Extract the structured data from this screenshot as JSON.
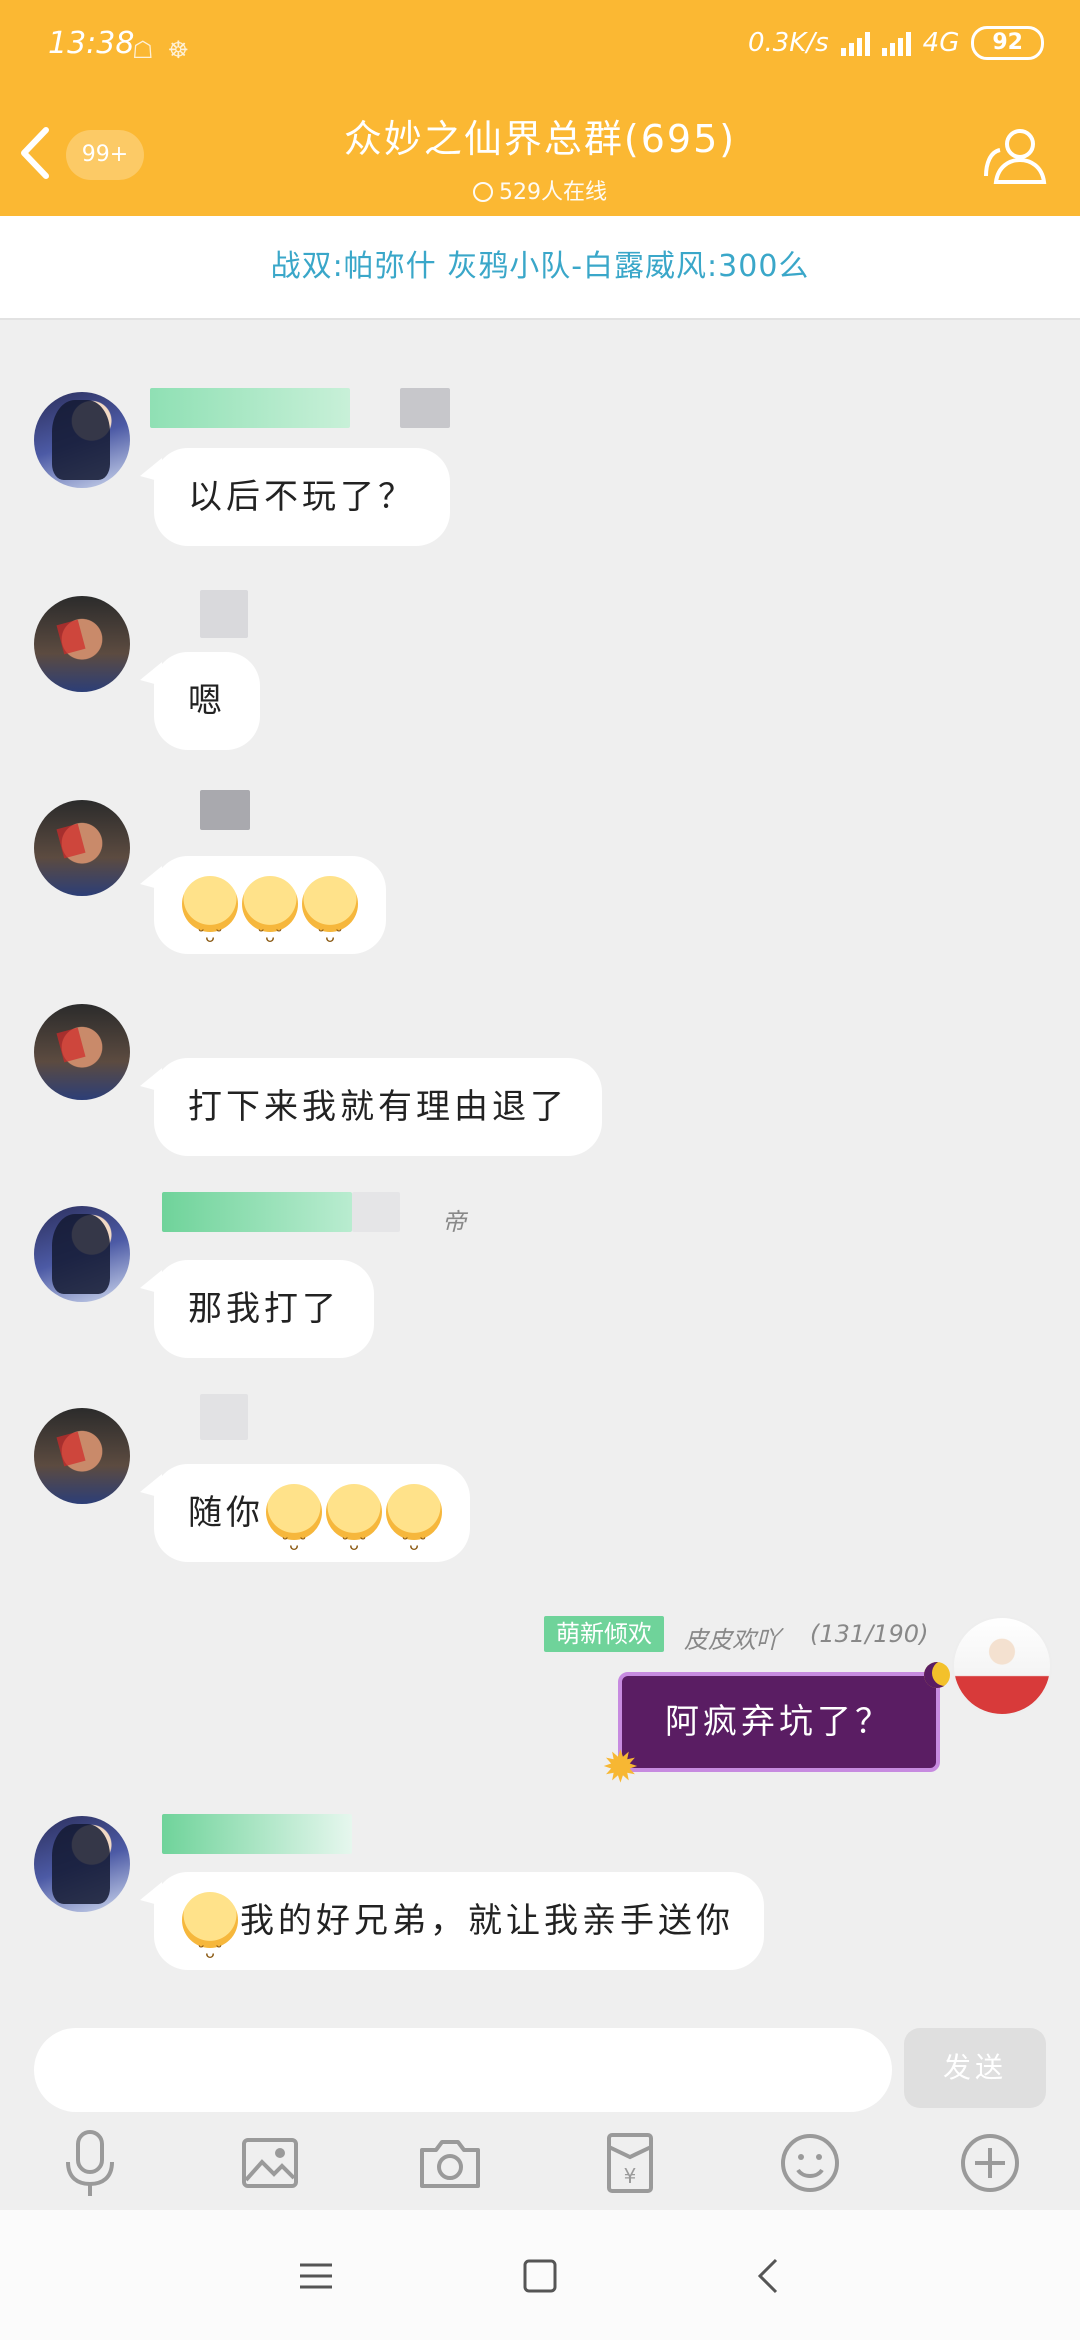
{
  "status_bar": {
    "time": "13:38",
    "speed": "0.3K/s",
    "network": "4G",
    "battery": "92"
  },
  "header": {
    "unread": "99+",
    "title": "众妙之仙界总群(695)",
    "online": "529人在线"
  },
  "notice": "战双:帕弥什 灰鸦小队-白露威风:300么",
  "messages": [
    {
      "text": "以后不玩了？"
    },
    {
      "text": "嗯"
    },
    {
      "text": ""
    },
    {
      "text": "打下来我就有理由退了"
    },
    {
      "text": "那我打了",
      "name_fragment": "帝"
    },
    {
      "text": "随你"
    },
    {
      "tag": "萌新倾欢",
      "name": "皮皮欢吖",
      "level": "(131/190)",
      "text": "阿疯弃坑了？"
    },
    {
      "text": "我的好兄弟，就让我亲手送你"
    }
  ],
  "input": {
    "send_label": "发送"
  },
  "colors": {
    "header_bg": "#fbb833",
    "notice_text": "#3aa7c9",
    "tag_green": "#6fd39a",
    "my_bubble": "#5a1d63"
  },
  "toolbar_icons": [
    "microphone-icon",
    "image-icon",
    "camera-icon",
    "red-packet-icon",
    "emoji-icon",
    "plus-icon"
  ],
  "nav_icons": [
    "menu-icon",
    "home-icon",
    "back-icon"
  ]
}
